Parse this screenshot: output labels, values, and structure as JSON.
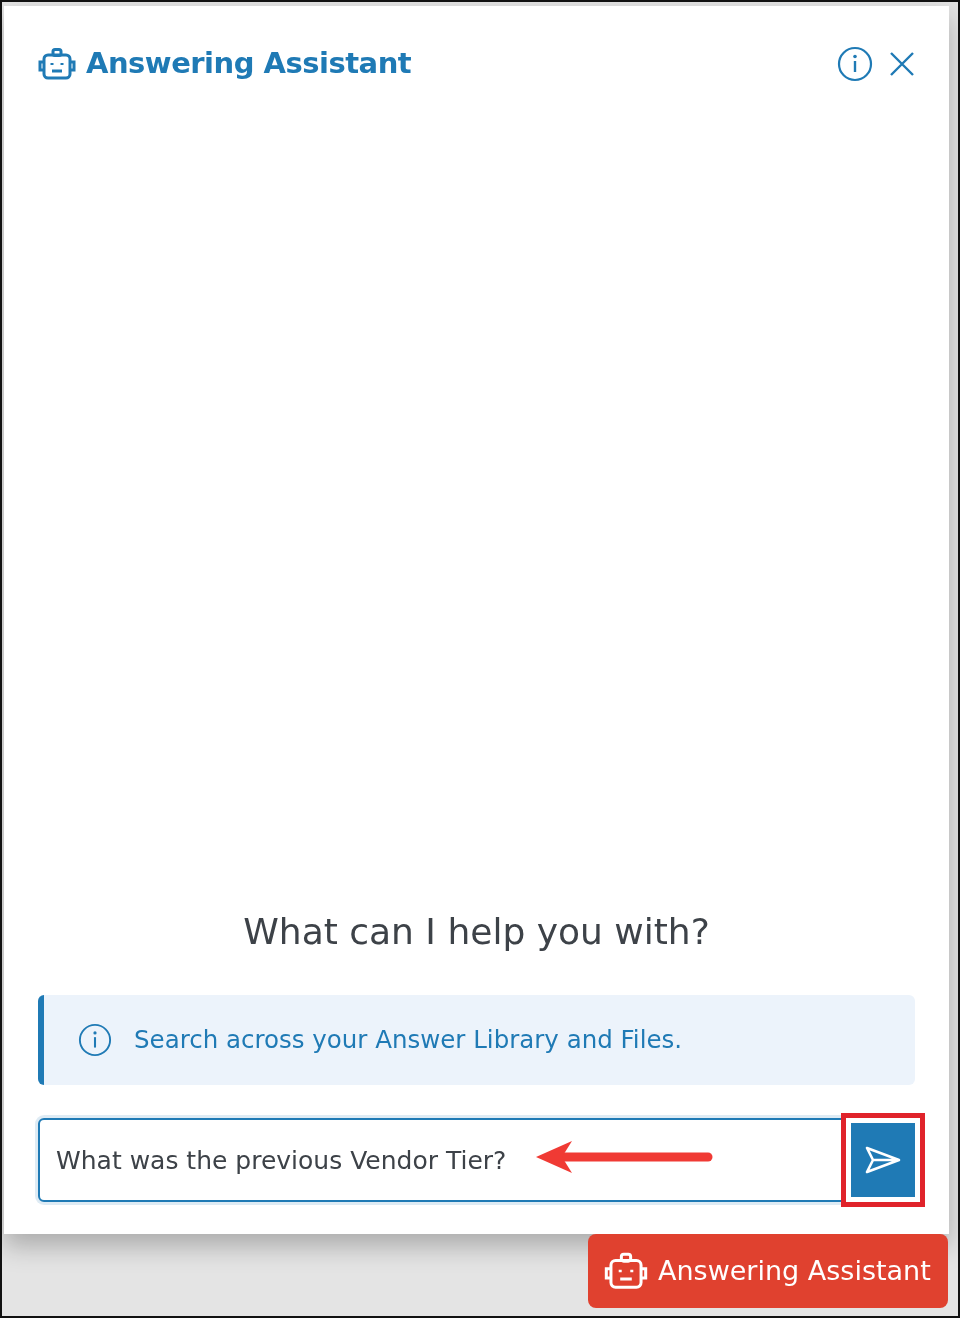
{
  "panel": {
    "title": "Answering Assistant"
  },
  "prompt": "What can I help you with?",
  "notice": "Search across your Answer Library and Files.",
  "question_field": {
    "value": "What was the previous Vendor Tier?",
    "focused": true
  },
  "send_button": {
    "highlighted": true
  },
  "launcher_button": {
    "label": "Answering Assistant"
  }
}
